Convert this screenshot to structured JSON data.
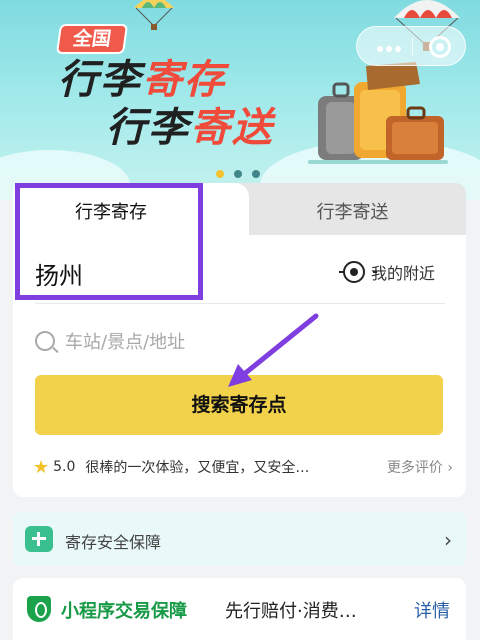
{
  "banner": {
    "badge": "全国",
    "line1_dark": "行李",
    "line1_red": "寄存",
    "line2_dark": "行李",
    "line2_red": "寄送"
  },
  "tabs": [
    {
      "label": "行李寄存",
      "active": true
    },
    {
      "label": "行李寄送",
      "active": false
    }
  ],
  "location": {
    "city": "扬州",
    "nearby_label": "我的附近"
  },
  "search": {
    "placeholder": "车站/景点/地址",
    "button_label": "搜索寄存点"
  },
  "review": {
    "score": "5.0",
    "text": "很棒的一次体验，又便宜，又安全…",
    "more": "更多评价"
  },
  "security": {
    "label": "寄存安全保障"
  },
  "guarantee": {
    "title": "小程序交易保障",
    "desc": "先行赔付·消费…",
    "link": "详情"
  },
  "colors": {
    "accent_yellow": "#f2d24b",
    "brand_red": "#f04a3a",
    "annotation_purple": "#7f3fe0",
    "guarantee_green": "#179a45"
  }
}
